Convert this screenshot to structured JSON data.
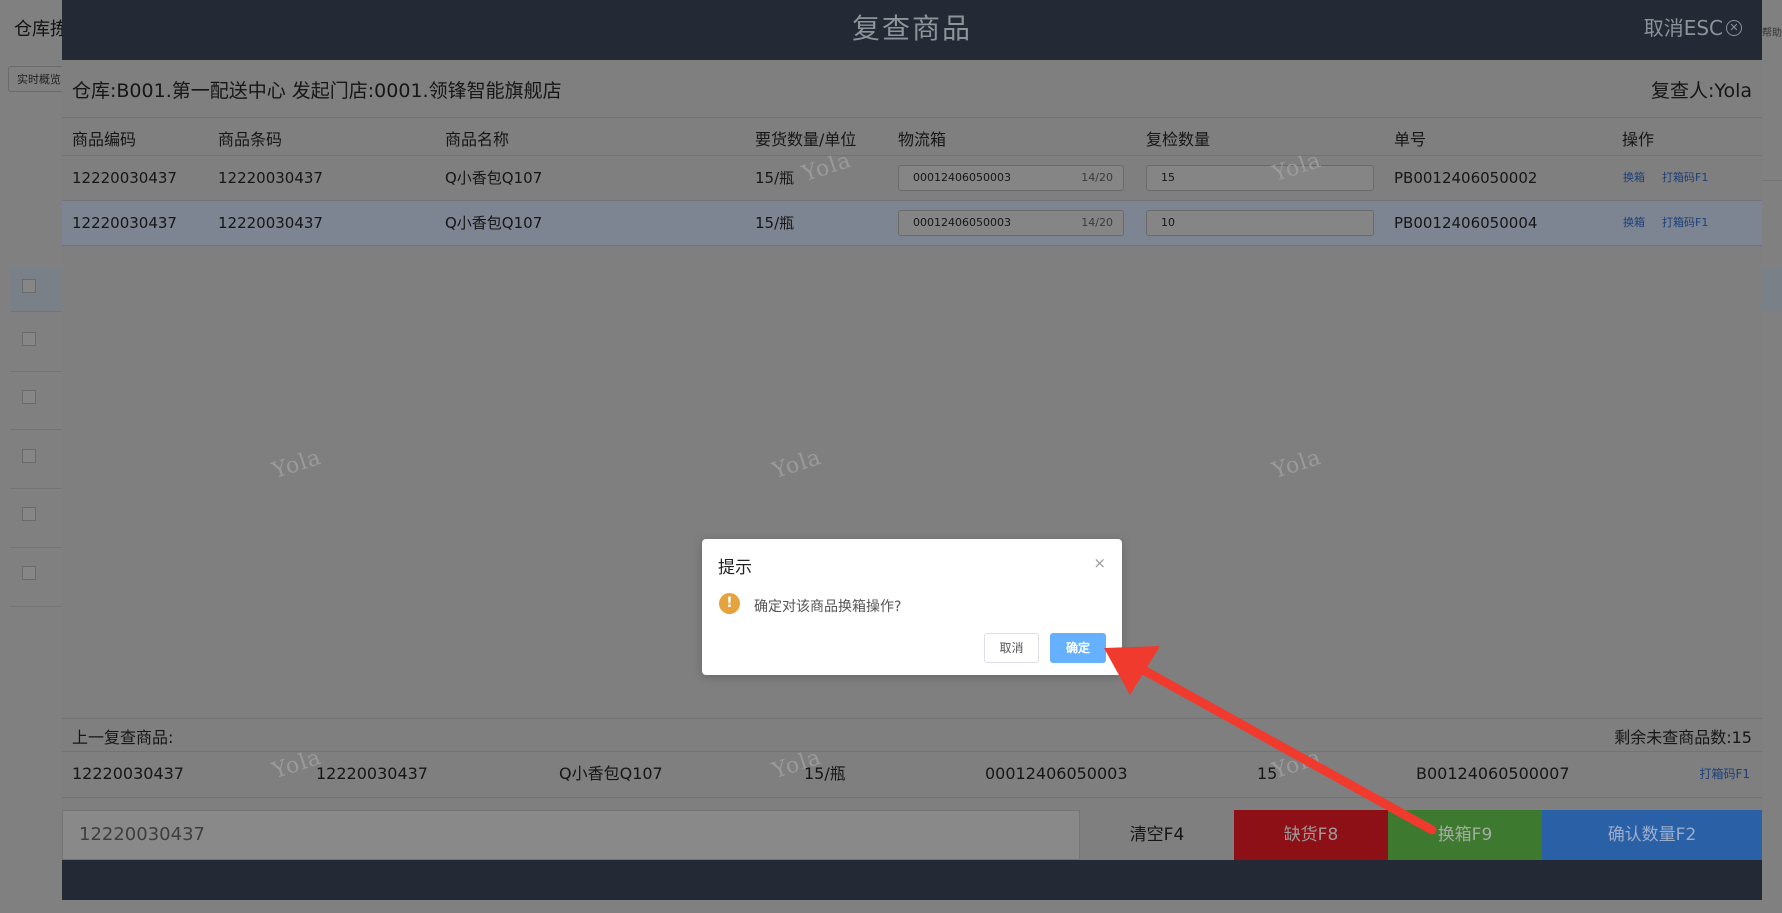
{
  "background": {
    "title": "仓库拣",
    "tab_label": "实时概览",
    "help_text": "帮助"
  },
  "modal": {
    "title": "复查商品",
    "cancel_label": "取消ESC",
    "info": "仓库:B001.第一配送中心 发起门店:0001.领锋智能旗舰店",
    "reviewer": "复查人:Yola",
    "columns": [
      "商品编码",
      "商品条码",
      "商品名称",
      "要货数量/单位",
      "物流箱",
      "复检数量",
      "单号",
      "操作"
    ],
    "rows": [
      {
        "code": "12220030437",
        "barcode": "12220030437",
        "name": "Q小香包Q107",
        "qty_unit": "15/瓶",
        "box": "00012406050003",
        "box_count": "14/20",
        "check_qty": "15",
        "order_no": "PB0012406050002",
        "action_swap": "换箱",
        "action_print": "打箱码F1"
      },
      {
        "code": "12220030437",
        "barcode": "12220030437",
        "name": "Q小香包Q107",
        "qty_unit": "15/瓶",
        "box": "00012406050003",
        "box_count": "14/20",
        "check_qty": "10",
        "order_no": "PB0012406050004",
        "action_swap": "换箱",
        "action_print": "打箱码F1"
      }
    ],
    "watermark": "Yola",
    "prev": {
      "label": "上一复查商品:",
      "remaining": "剩余未查商品数:15",
      "code": "12220030437",
      "barcode": "12220030437",
      "name": "Q小香包Q107",
      "qty_unit": "15/瓶",
      "box": "00012406050003",
      "qty": "15",
      "order_no": "B00124060500007",
      "print_label": "打箱码F1"
    },
    "scan_value": "12220030437",
    "buttons": {
      "clear": "清空F4",
      "shortage": "缺货F8",
      "swap": "换箱F9",
      "confirm": "确认数量F2"
    }
  },
  "dialog": {
    "title": "提示",
    "close": "×",
    "icon": "!",
    "message": "确定对该商品换箱操作?",
    "cancel": "取消",
    "ok": "确定"
  },
  "colors": {
    "header": "#232a36",
    "shortage": "#8c1016",
    "swap": "#3d7a30",
    "confirm": "#2a61a6",
    "primary": "#66b1ff",
    "warning": "#e6a23c",
    "arrow": "#f03a2e"
  }
}
